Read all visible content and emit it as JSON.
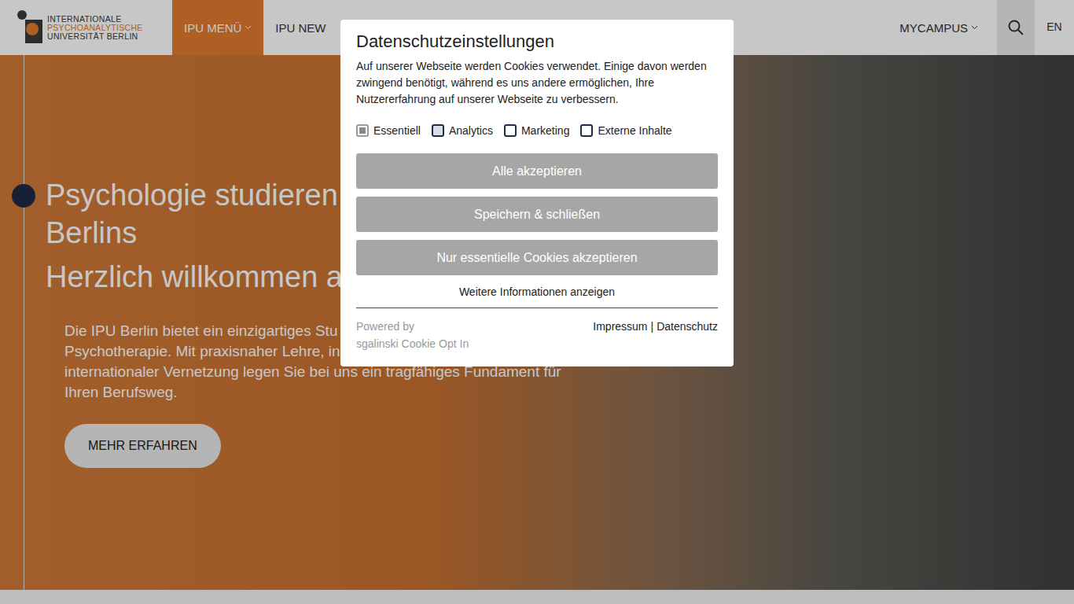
{
  "header": {
    "logo": [
      "INTERNATIONALE",
      "PSYCHOANALYTISCHE",
      "UNIVERSITÄT BERLIN"
    ],
    "nav": [
      {
        "label": "IPU MENÜ",
        "selected": true,
        "dropdown": true
      },
      {
        "label": "IPU NEW",
        "selected": false,
        "dropdown": false
      }
    ],
    "mycampus": "MYCAMPUS",
    "lang": "EN"
  },
  "hero": {
    "title_lines": [
      "Psychologie studieren",
      "Berlins"
    ],
    "subtitle": "Herzlich willkommen a",
    "text_lines": [
      "Die IPU Berlin bietet ein einzigartiges Stu",
      "Psychotherapie. Mit praxisnaher Lehre, in",
      "internationaler Vernetzung legen Sie bei uns ein tragfähiges Fundament für",
      "Ihren Berufsweg."
    ],
    "button": "MEHR ERFAHREN"
  },
  "dialog": {
    "title": "Datenschutzeinstellungen",
    "text": "Auf unserer Webseite werden Cookies verwendet. Einige davon werden zwingend benötigt, während es uns andere ermöglichen, Ihre Nutzererfahrung auf unserer Webseite zu verbessern.",
    "options": [
      {
        "label": "Essentiell",
        "checked": true,
        "disabled": true,
        "focused": false
      },
      {
        "label": "Analytics",
        "checked": false,
        "disabled": false,
        "focused": true
      },
      {
        "label": "Marketing",
        "checked": false,
        "disabled": false,
        "focused": false
      },
      {
        "label": "Externe Inhalte",
        "checked": false,
        "disabled": false,
        "focused": false
      }
    ],
    "buttons": [
      "Alle akzeptieren",
      "Speichern & schließen",
      "Nur essentielle Cookies akzeptieren"
    ],
    "more": "Weitere Informationen anzeigen",
    "powered": [
      "Powered by",
      "sgalinski Cookie Opt In"
    ],
    "links": [
      "Impressum",
      "|",
      "Datenschutz"
    ]
  }
}
